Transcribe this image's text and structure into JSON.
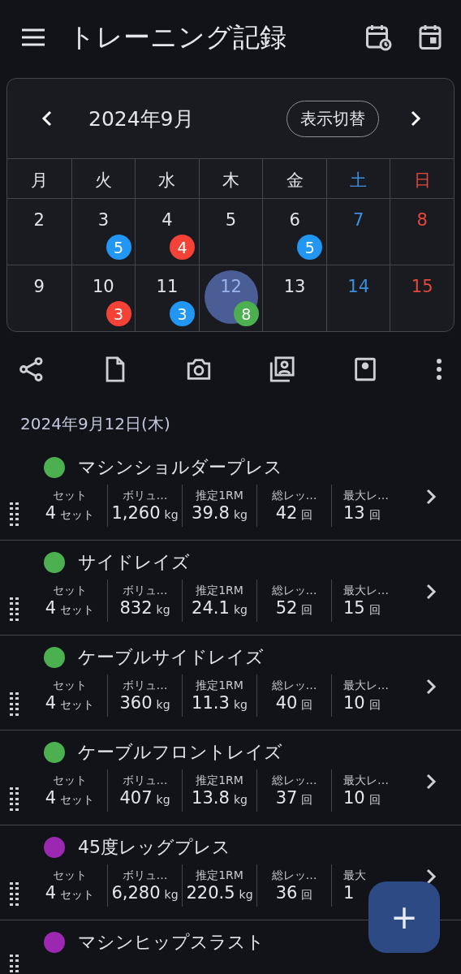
{
  "app_bar": {
    "title": "トレーニング記録"
  },
  "calendar": {
    "month": "2024年9月",
    "toggle_label": "表示切替",
    "weekdays": [
      {
        "label": "月",
        "kind": "weekday"
      },
      {
        "label": "火",
        "kind": "weekday"
      },
      {
        "label": "水",
        "kind": "weekday"
      },
      {
        "label": "木",
        "kind": "weekday"
      },
      {
        "label": "金",
        "kind": "weekday"
      },
      {
        "label": "土",
        "kind": "saturday"
      },
      {
        "label": "日",
        "kind": "sunday"
      }
    ],
    "weeks": [
      [
        {
          "day": "2",
          "kind": "weekday",
          "selected": false
        },
        {
          "day": "3",
          "kind": "weekday",
          "selected": false,
          "count": "5",
          "color": "#2196f3"
        },
        {
          "day": "4",
          "kind": "weekday",
          "selected": false,
          "count": "4",
          "color": "#f44336"
        },
        {
          "day": "5",
          "kind": "weekday",
          "selected": false
        },
        {
          "day": "6",
          "kind": "weekday",
          "selected": false,
          "count": "5",
          "color": "#2196f3"
        },
        {
          "day": "7",
          "kind": "saturday",
          "selected": false
        },
        {
          "day": "8",
          "kind": "sunday",
          "selected": false
        }
      ],
      [
        {
          "day": "9",
          "kind": "weekday",
          "selected": false
        },
        {
          "day": "10",
          "kind": "weekday",
          "selected": false,
          "count": "3",
          "color": "#f44336"
        },
        {
          "day": "11",
          "kind": "weekday",
          "selected": false,
          "count": "3",
          "color": "#2196f3"
        },
        {
          "day": "12",
          "kind": "weekday",
          "selected": true,
          "count": "8",
          "color": "#4caf50"
        },
        {
          "day": "13",
          "kind": "weekday",
          "selected": false
        },
        {
          "day": "14",
          "kind": "saturday",
          "selected": false
        },
        {
          "day": "15",
          "kind": "sunday",
          "selected": false
        }
      ]
    ]
  },
  "date_heading": "2024年9月12日(木)",
  "exercises": [
    {
      "name": "マシンショルダープレス",
      "color": "#4caf50",
      "stats": [
        {
          "label": "セット",
          "value": "4",
          "unit": "セット"
        },
        {
          "label": "ボリュ…",
          "value": "1,260",
          "unit": "kg"
        },
        {
          "label": "推定1RM",
          "value": "39.8",
          "unit": "kg"
        },
        {
          "label": "総レッ…",
          "value": "42",
          "unit": "回"
        },
        {
          "label": "最大レ…",
          "value": "13",
          "unit": "回"
        }
      ]
    },
    {
      "name": "サイドレイズ",
      "color": "#4caf50",
      "stats": [
        {
          "label": "セット",
          "value": "4",
          "unit": "セット"
        },
        {
          "label": "ボリュ…",
          "value": "832",
          "unit": "kg"
        },
        {
          "label": "推定1RM",
          "value": "24.1",
          "unit": "kg"
        },
        {
          "label": "総レッ…",
          "value": "52",
          "unit": "回"
        },
        {
          "label": "最大レ…",
          "value": "15",
          "unit": "回"
        }
      ]
    },
    {
      "name": "ケーブルサイドレイズ",
      "color": "#4caf50",
      "stats": [
        {
          "label": "セット",
          "value": "4",
          "unit": "セット"
        },
        {
          "label": "ボリュ…",
          "value": "360",
          "unit": "kg"
        },
        {
          "label": "推定1RM",
          "value": "11.3",
          "unit": "kg"
        },
        {
          "label": "総レッ…",
          "value": "40",
          "unit": "回"
        },
        {
          "label": "最大レ…",
          "value": "10",
          "unit": "回"
        }
      ]
    },
    {
      "name": "ケーブルフロントレイズ",
      "color": "#4caf50",
      "stats": [
        {
          "label": "セット",
          "value": "4",
          "unit": "セット"
        },
        {
          "label": "ボリュ…",
          "value": "407",
          "unit": "kg"
        },
        {
          "label": "推定1RM",
          "value": "13.8",
          "unit": "kg"
        },
        {
          "label": "総レッ…",
          "value": "37",
          "unit": "回"
        },
        {
          "label": "最大レ…",
          "value": "10",
          "unit": "回"
        }
      ]
    },
    {
      "name": "45度レッグプレス",
      "color": "#9c27b0",
      "stats": [
        {
          "label": "セット",
          "value": "4",
          "unit": "セット"
        },
        {
          "label": "ボリュ…",
          "value": "6,280",
          "unit": "kg"
        },
        {
          "label": "推定1RM",
          "value": "220.5",
          "unit": "kg"
        },
        {
          "label": "総レッ…",
          "value": "36",
          "unit": "回"
        },
        {
          "label": "最大",
          "value": "1"
        }
      ]
    },
    {
      "name": "マシンヒップスラスト",
      "color": "#9c27b0"
    }
  ],
  "fab": {
    "label": "+"
  }
}
